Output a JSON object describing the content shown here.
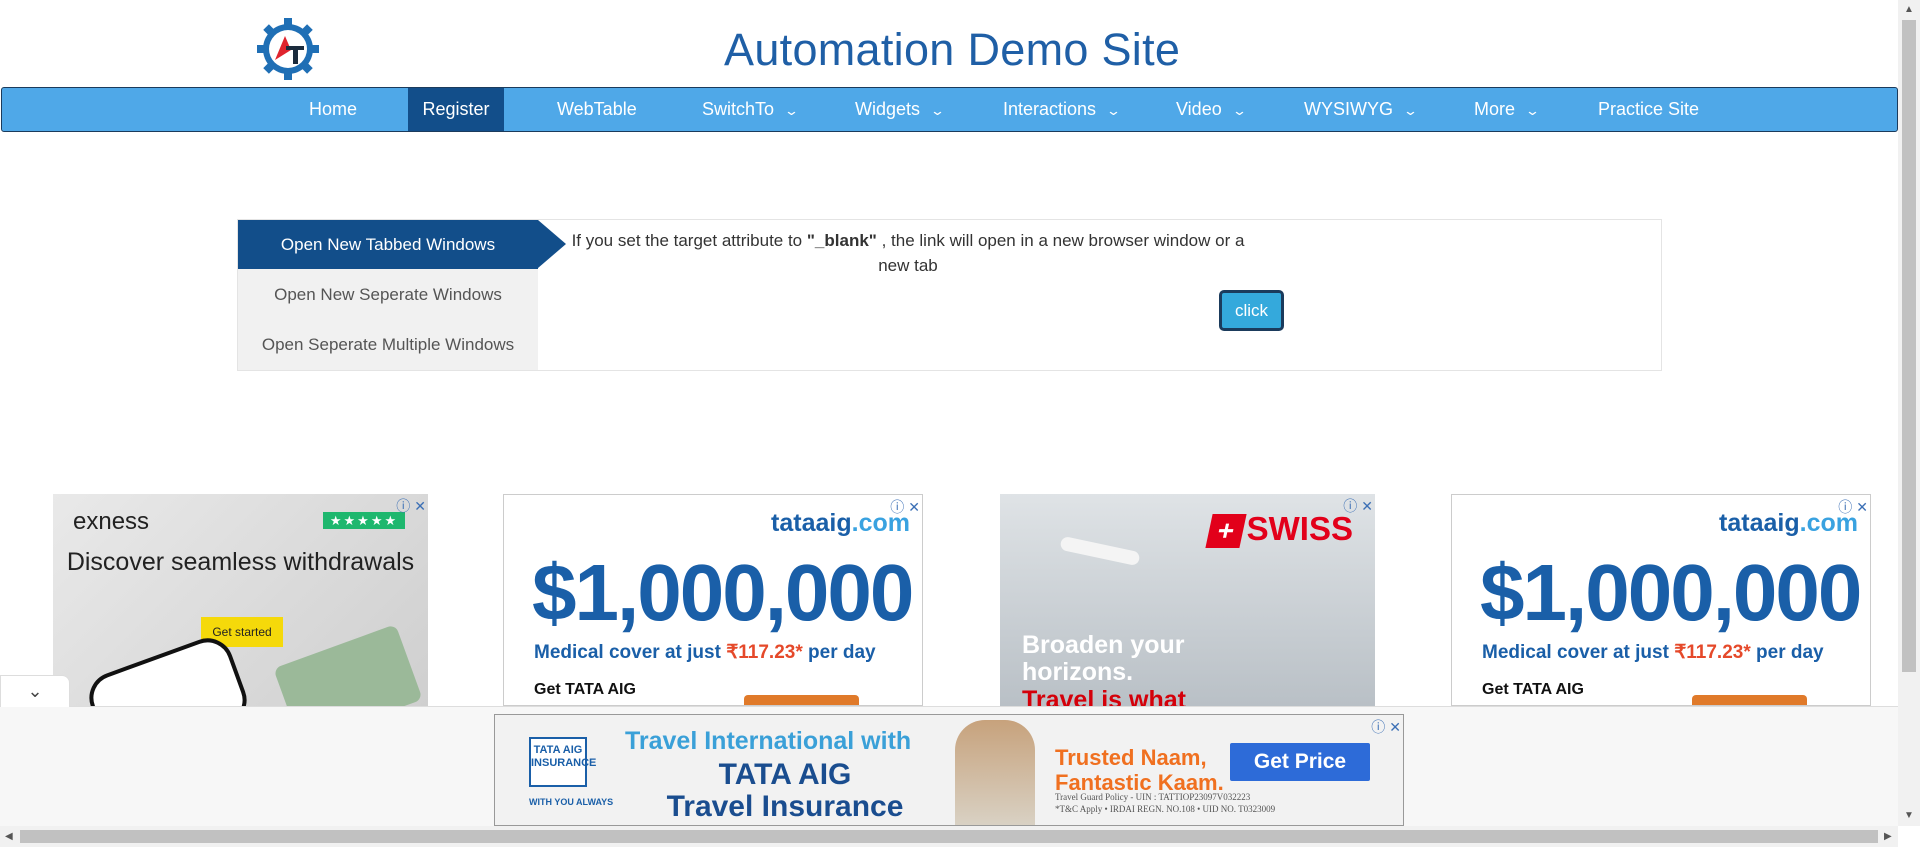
{
  "header": {
    "title": "Automation Demo Site",
    "logo_letters": "AT"
  },
  "nav": {
    "items": [
      {
        "label": "Home",
        "dropdown": false
      },
      {
        "label": "Register",
        "dropdown": false,
        "active": true
      },
      {
        "label": "WebTable",
        "dropdown": false
      },
      {
        "label": "SwitchTo",
        "dropdown": true
      },
      {
        "label": "Widgets",
        "dropdown": true
      },
      {
        "label": "Interactions",
        "dropdown": true
      },
      {
        "label": "Video",
        "dropdown": true
      },
      {
        "label": "WYSIWYG",
        "dropdown": true
      },
      {
        "label": "More",
        "dropdown": true
      },
      {
        "label": "Practice Site",
        "dropdown": false
      }
    ],
    "chevron": "⌄"
  },
  "tabs": {
    "items": [
      {
        "label": "Open New Tabbed Windows",
        "active": true
      },
      {
        "label": "Open New Seperate Windows"
      },
      {
        "label": "Open Seperate Multiple Windows"
      }
    ],
    "content": {
      "text_before": "If you set the target attribute to ",
      "text_bold": "\"_blank\"",
      "text_after": " , the link will open in a new browser window or a new tab",
      "button": "click"
    }
  },
  "ads": {
    "controls": {
      "info": "ⓘ",
      "close": "✕"
    },
    "exness": {
      "brand": "exness",
      "stars": "★★★★★",
      "headline": "Discover seamless withdrawals",
      "cta": "Get started"
    },
    "tata": {
      "logo": "tataaig",
      "logo_suffix": ".com",
      "amount": "$1,000,000",
      "medical_prefix": "Medical cover at just ",
      "medical_price": "₹117.23*",
      "medical_suffix": " per day",
      "get": "Get TATA AIG"
    },
    "swiss": {
      "brand": "SWISS",
      "cross": "+",
      "line1": "Broaden your",
      "line2": "horizons.",
      "line3": "Travel is what"
    },
    "banner": {
      "badge": "TATA AIG INSURANCE",
      "badge_sub": "WITH YOU ALWAYS",
      "line1": "Travel International with",
      "line2": "TATA AIG",
      "line3": "Travel Insurance",
      "trusted1": "Trusted Naam,",
      "trusted2": "Fantastic Kaam.",
      "cta": "Get Price",
      "fine1": "Travel Guard Policy - UIN : TATTIOP23097V032223",
      "fine2": "*T&C Apply  •  IRDAI REGN. NO.108  •  UID NO. T0323009"
    }
  },
  "overlay": {
    "collapse_icon": "⌄"
  },
  "colors": {
    "nav_bg": "#4fa8e8",
    "nav_active": "#124e8a",
    "title": "#1f5fa6",
    "button": "#34a9dc"
  }
}
